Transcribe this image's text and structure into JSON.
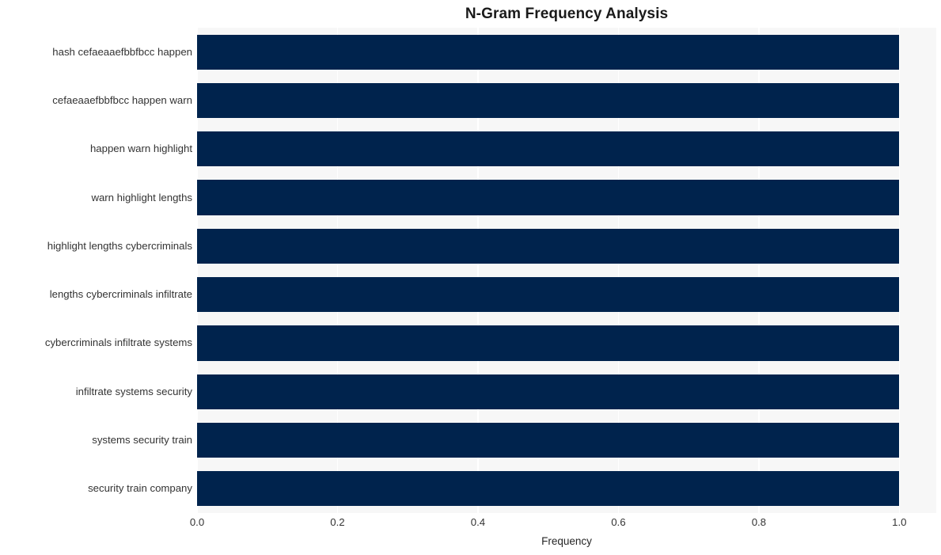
{
  "chart_data": {
    "type": "bar",
    "orientation": "horizontal",
    "title": "N-Gram Frequency Analysis",
    "xlabel": "Frequency",
    "ylabel": "",
    "categories": [
      "hash cefaeaaefbbfbcc happen",
      "cefaeaaefbbfbcc happen warn",
      "happen warn highlight",
      "warn highlight lengths",
      "highlight lengths cybercriminals",
      "lengths cybercriminals infiltrate",
      "cybercriminals infiltrate systems",
      "infiltrate systems security",
      "systems security train",
      "security train company"
    ],
    "values": [
      1.0,
      1.0,
      1.0,
      1.0,
      1.0,
      1.0,
      1.0,
      1.0,
      1.0,
      1.0
    ],
    "xlim": [
      0.0,
      1.0526
    ],
    "x_ticks": [
      0.0,
      0.2,
      0.4,
      0.6,
      0.8,
      1.0
    ],
    "x_tick_labels": [
      "0.0",
      "0.2",
      "0.4",
      "0.6",
      "0.8",
      "1.0"
    ],
    "grid": "vertical-only",
    "legend": "none",
    "bar_color": "#00234d",
    "plot_background": "#f7f7f7",
    "gridline_color": "#ffffff",
    "figure_background": "#ffffff"
  }
}
